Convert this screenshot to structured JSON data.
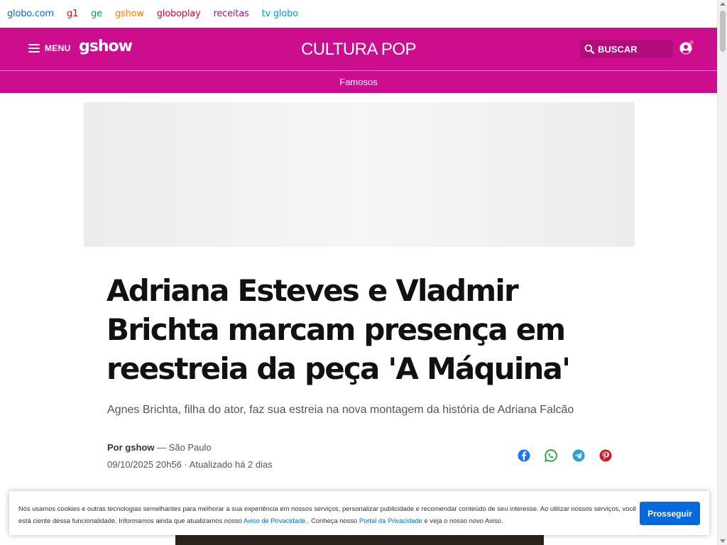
{
  "globo_bar": {
    "links": [
      {
        "label": "globo.com",
        "color": "#0669de"
      },
      {
        "label": "g1",
        "color": "#c4170c"
      },
      {
        "label": "ge",
        "color": "#06aa48"
      },
      {
        "label": "gshow",
        "color": "#ff7f00"
      },
      {
        "label": "globoplay",
        "color": "#e4003d"
      },
      {
        "label": "receitas",
        "color": "#9c1b7b"
      },
      {
        "label": "tv globo",
        "color": "#00a0dc"
      }
    ]
  },
  "header": {
    "menu_label": "MENU",
    "logo": "gshow",
    "section_title": "CULTURA POP",
    "search_label": "BUSCAR",
    "brand_color": "#cc0e8e"
  },
  "subnav": {
    "item": "Famosos"
  },
  "article": {
    "headline": "Adriana Esteves e Vladmir Brichta marcam presença em reestreia da peça 'A Máquina'",
    "subtitle": "Agnes Brichta, filha do ator, faz sua estreia na nova montagem da história de Adriana Falcão",
    "byline_author": "Por gshow",
    "byline_location": " — São Paulo",
    "dateline": "09/10/2025 20h56 · Atualizado há 2 dias",
    "share_icons": [
      "facebook-icon",
      "whatsapp-icon",
      "telegram-icon",
      "pinterest-icon"
    ]
  },
  "cookie_banner": {
    "text_1": "Nós usamos cookies e outras tecnologias semelhantes para melhorar a sua experiência em nossos serviços, personalizar publicidade e recomendar conteúdo de seu interesse. Ao utilizar nossos serviços, você está ciente dessa funcionalidade. Informamos ainda que atualizamos nosso ",
    "link_privacy": "Aviso de Privacidade.",
    "text_2": ". Conheça nosso ",
    "link_portal": "Portal da Privacidade",
    "text_3": " e veja o nosso novo Aviso.",
    "button": "Prosseguir",
    "button_color": "#0669de"
  }
}
